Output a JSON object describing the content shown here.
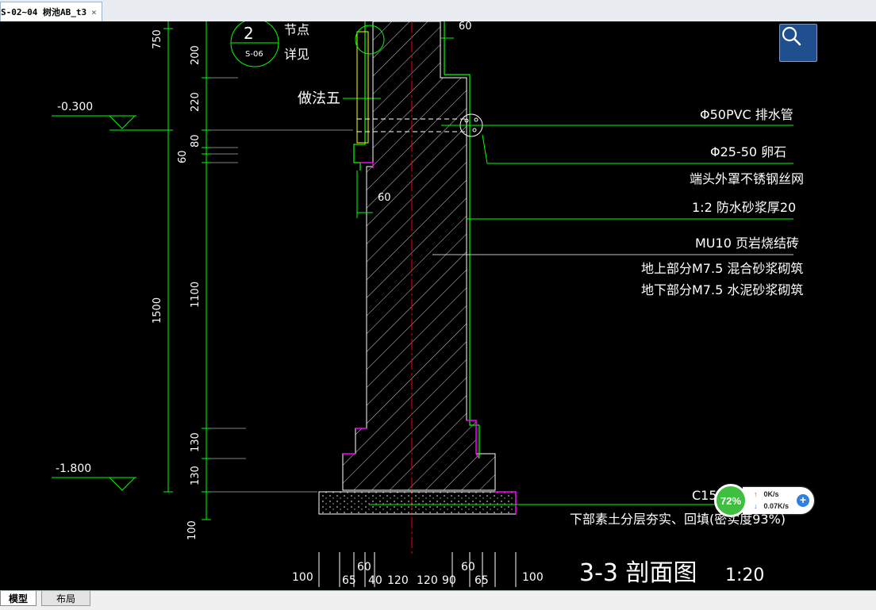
{
  "document_tab": {
    "title": "S-02~04 树池AB_t3",
    "close_label": "×"
  },
  "drawing": {
    "elevations": {
      "top": "-0.300",
      "bottom": "-1.800"
    },
    "left_dims_outer": [
      "750",
      "1500",
      "100"
    ],
    "left_dims_inner": [
      "200",
      "220",
      "80",
      "60",
      "1100",
      "130",
      "130"
    ],
    "detail_ref": {
      "number": "2",
      "sheet": "S-06",
      "line1": "节点",
      "line2": "详见"
    },
    "method_label": "做法五",
    "dim_60_side": "60",
    "dim_60_top": "60",
    "callouts": [
      {
        "text": "Φ50PVC   排水管"
      },
      {
        "text": "Φ25-50      卵石"
      },
      {
        "text": "端头外罩不锈钢丝网"
      },
      {
        "text": "1:2  防水砂浆厚20"
      },
      {
        "text": "MU10   页岩烧结砖"
      },
      {
        "text": "地上部分M7.5   混合砂浆砌筑"
      },
      {
        "text": "地下部分M7.5   水泥砂浆砌筑"
      },
      {
        "text": "C15        垫层"
      },
      {
        "text": "下部素土分层夯实、回填(密实度93%)"
      }
    ],
    "bottom_dims": [
      "100",
      "65",
      "60",
      "40",
      "120",
      "120",
      "90",
      "60",
      "65",
      "100"
    ],
    "section_title": "3-3   剖面图",
    "section_scale": "1:20"
  },
  "search_icon": "magnifier-icon",
  "net_widget": {
    "percent": "72%",
    "up": "0K/s",
    "down": "0.07K/s",
    "plus": "+"
  },
  "layout_tabs": [
    {
      "label": "模型"
    },
    {
      "label": "布局"
    }
  ],
  "colors": {
    "cad_green": "#00ff00",
    "cad_magenta": "#ff00ff",
    "cad_red": "#ff0000",
    "cad_white": "#ffffff",
    "search_blue": "#1f4f8f"
  }
}
